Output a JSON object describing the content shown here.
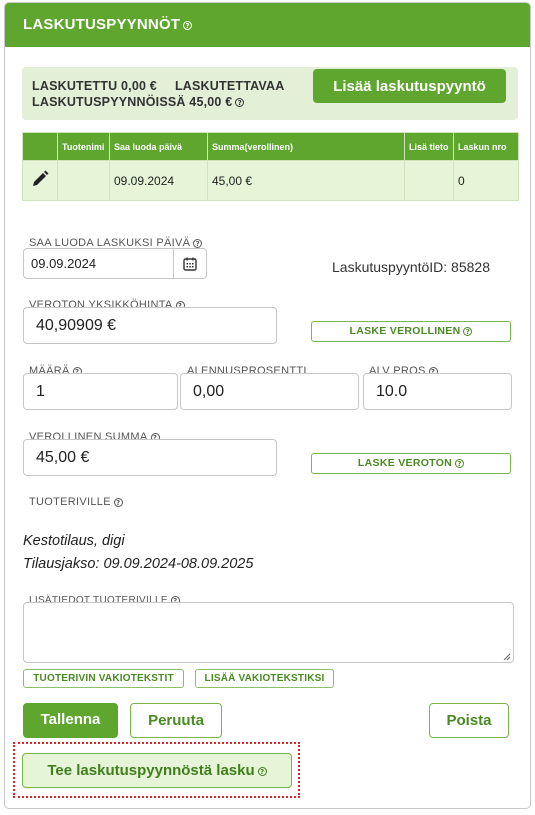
{
  "header": {
    "title": "LASKUTUSPYYNNÖT"
  },
  "summary": {
    "invoiced": "LASKUTETTU 0,00 €",
    "to_invoice": "LASKUTETTAVAA",
    "in_requests": "LASKUTUSPYYNNÖISSÄ 45,00 €",
    "add_button": "Lisää laskutuspyyntö"
  },
  "table": {
    "columns": [
      "",
      "Tuotenimi",
      "Saa luoda päivä",
      "Summa(verollinen)",
      "Lisä tieto",
      "Laskun nro"
    ],
    "rows": [
      {
        "icon": "edit-icon",
        "product": "",
        "date": "09.09.2024",
        "sum": "45,00 €",
        "info": "",
        "invoice_no": "0"
      }
    ]
  },
  "form": {
    "date_label": "SAA LUODA LASKUKSI PÄIVÄ",
    "date_value": "09.09.2024",
    "request_id": "LaskutuspyyntöID: 85828",
    "net_price_label": "VEROTON YKSIKKÖHINTA",
    "net_price_value": "40,90909 €",
    "calc_gross_button": "LASKE VEROLLINEN",
    "qty_label": "MÄÄRÄ",
    "qty_value": "1",
    "discount_label": "ALENNUSPROSENTTI",
    "discount_value": "0,00",
    "vat_label": "ALV PROS",
    "vat_value": "10.0",
    "gross_label": "VEROLLINEN SUMMA",
    "gross_value": "45,00 €",
    "calc_net_button": "LASKE VEROTON",
    "product_row_label": "TUOTERIVILLE",
    "product_text_line1": "Kestotilaus, digi",
    "product_text_line2": "Tilausjakso: 09.09.2024-08.09.2025",
    "extra_info_label": "LISÄTIEDOT TUOTERIVILLE",
    "extra_info_value": "",
    "std_texts_button": "TUOTERIVIN VAKIOTEKSTIT",
    "add_std_text_button": "LISÄÄ VAKIOTEKSTIKSI"
  },
  "actions": {
    "save": "Tallenna",
    "cancel": "Peruuta",
    "delete": "Poista",
    "create_invoice": "Tee laskutuspyynnöstä lasku"
  },
  "colors": {
    "accent": "#5ea62e",
    "row_bg": "#e6f4d8",
    "summary_bg": "#e3efd6",
    "focus_outline": "#d9262b"
  }
}
